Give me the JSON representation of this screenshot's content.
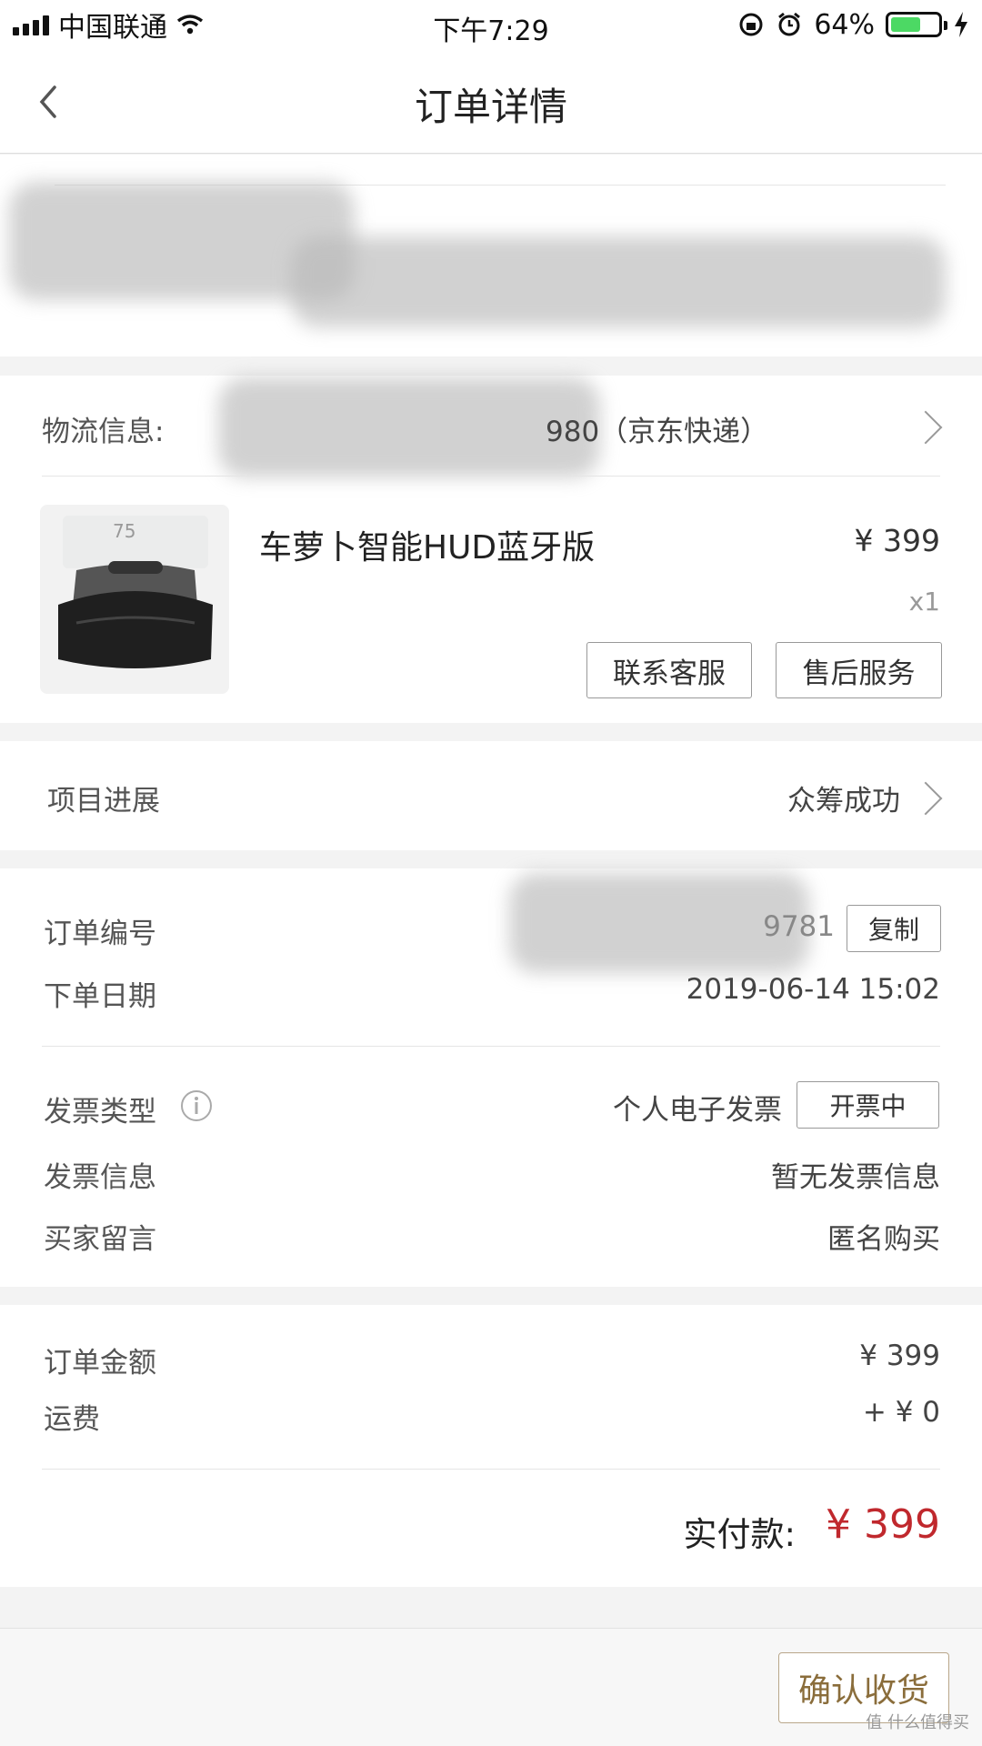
{
  "status_bar": {
    "carrier": "中国联通",
    "time": "下午7:29",
    "battery_percent": "64%",
    "battery_level": 0.64
  },
  "navbar": {
    "title": "订单详情"
  },
  "logistics": {
    "label": "物流信息:",
    "value_partial": "980（京东快递）"
  },
  "product": {
    "name": "车萝卜智能HUD蓝牙版",
    "price": "¥ 399",
    "quantity": "x1",
    "contact_service_label": "联系客服",
    "after_sales_label": "售后服务"
  },
  "progress": {
    "label": "项目进展",
    "value": "众筹成功"
  },
  "order_info": {
    "order_number_label": "订单编号",
    "order_number_partial": "9781",
    "copy_label": "复制",
    "order_date_label": "下单日期",
    "order_date": "2019-06-14 15:02",
    "invoice_type_label": "发票类型",
    "invoice_type_value": "个人电子发票",
    "invoice_status": "开票中",
    "invoice_info_label": "发票信息",
    "invoice_info_value": "暂无发票信息",
    "buyer_message_label": "买家留言",
    "buyer_message_value": "匿名购买"
  },
  "amounts": {
    "order_amount_label": "订单金额",
    "order_amount": "¥ 399",
    "shipping_label": "运费",
    "shipping": "+ ¥ 0",
    "paid_label": "实付款:",
    "paid_value": "¥ 399"
  },
  "footer": {
    "confirm_label": "确认收货",
    "watermark": "值 什么值得买"
  },
  "colors": {
    "accent_red": "#c0282d",
    "gold_button": "#8a6d3b",
    "battery_green": "#4cd964"
  }
}
